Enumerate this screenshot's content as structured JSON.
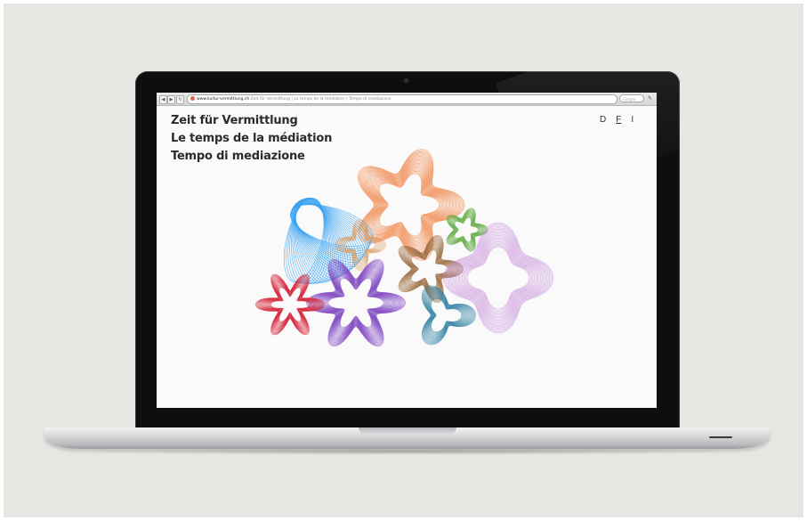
{
  "browser": {
    "url_host": "www.kultur-vermittlung.ch",
    "url_rest": " Zeit für Vermittlung | Le temps de la médiation | Tempo di mediazione",
    "search_placeholder": "Google",
    "back_icon": "back-arrow-icon",
    "forward_icon": "forward-arrow-icon",
    "reload_icon": "reload-icon",
    "settings_icon": "wrench-icon"
  },
  "page": {
    "title_lines": [
      "Zeit für Vermittlung",
      "Le temps de la médiation",
      "Tempo di mediazione"
    ],
    "languages": [
      "D",
      "F",
      "I"
    ],
    "active_language": "F"
  },
  "colors": {
    "blue": "#3aa3f2",
    "orange": "#f07a37",
    "green": "#5aa83a",
    "tan": "#d99a5c",
    "brown": "#9a6a3c",
    "purple": "#7a3fbf",
    "violet": "#c48ad8",
    "red": "#d42a3c",
    "teal": "#2a7ea0"
  }
}
